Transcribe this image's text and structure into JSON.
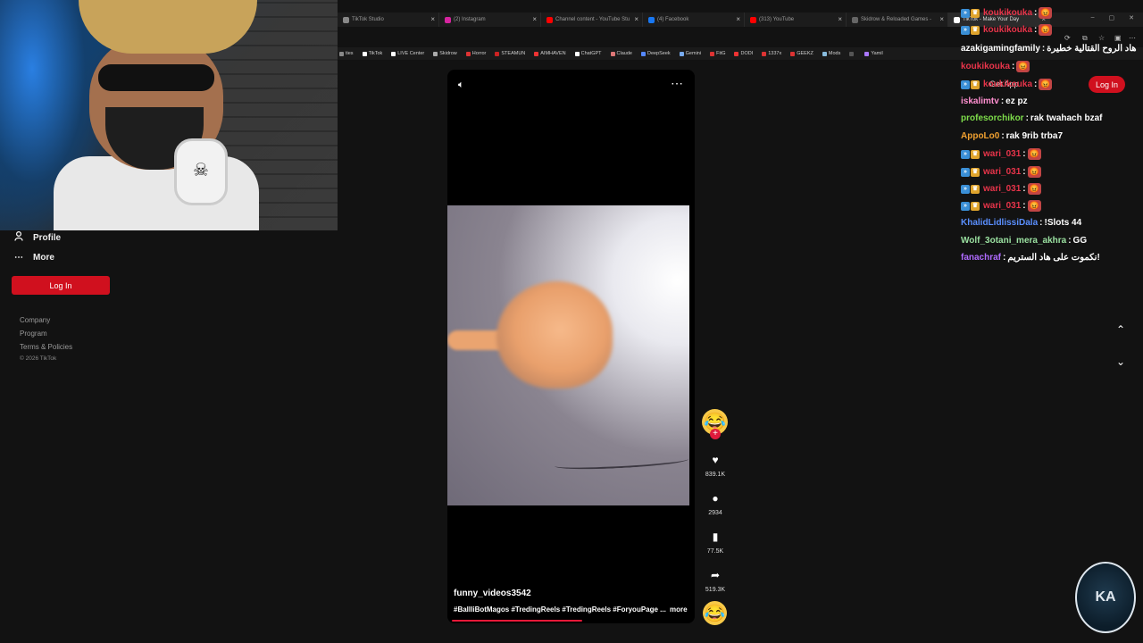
{
  "browser": {
    "tabs": [
      {
        "title": "TikTok Studio",
        "color": "#888888"
      },
      {
        "title": "(2) Instagram",
        "color": "#d6249f"
      },
      {
        "title": "Channel content - YouTube Stu",
        "color": "#ff0000"
      },
      {
        "title": "(4) Facebook",
        "color": "#1877f2"
      },
      {
        "title": "(313) YouTube",
        "color": "#ff0000"
      },
      {
        "title": "Skidrow & Reloaded Games - ",
        "color": "#666666"
      },
      {
        "title": "TikTok - Make Your Day",
        "color": "#ffffff"
      }
    ],
    "bookmarks": [
      "ties",
      "TikTok",
      "LIVE Center",
      "Skidrow",
      "Horror",
      "STEAMUN",
      "AIMHAVEN",
      "ChatGPT",
      "Claude",
      "DeepSeek",
      "Gemini",
      "FitG",
      "DODI",
      "1337x",
      "GEEKZ",
      "Mods",
      "",
      "Yamil"
    ],
    "favorites_label": "favorites"
  },
  "sidebar": {
    "profile_label": "Profile",
    "more_label": "More",
    "login_label": "Log In",
    "footer": [
      "Company",
      "Program",
      "Terms & Policies"
    ],
    "copyright": "© 2026 TikTok"
  },
  "header": {
    "get_app_label": "Get App",
    "login_label": "Log In"
  },
  "video": {
    "username": "funny_videos3542",
    "tags": "#BallliBotMagos #TredingReels #TredingReels #ForyouPage ...",
    "more_label": "more",
    "progress": 0.54,
    "likes": "839.1K",
    "comments": "2934",
    "saves": "77.5K",
    "shares": "519.3K"
  },
  "chat": {
    "messages": [
      {
        "user": "koukikouka",
        "color": "#e8344a",
        "text": "",
        "badges": true,
        "emote": true
      },
      {
        "user": "koukikouka",
        "color": "#e8344a",
        "text": "",
        "badges": true,
        "emote": true
      },
      {
        "user": "azakigamingfamily",
        "color": "#ffffff",
        "text": "هاد الروح القتالية خطيرة",
        "badges": false,
        "emote": false
      },
      {
        "user": "koukikouka",
        "color": "#e8344a",
        "text": "",
        "badges": false,
        "emote": true
      },
      {
        "user": "koukikouka",
        "color": "#e8344a",
        "text": "",
        "badges": true,
        "emote": true
      },
      {
        "user": "iskalimtv",
        "color": "#ff8fd0",
        "text": "ez pz",
        "badges": false,
        "emote": false
      },
      {
        "user": "profesorchikor",
        "color": "#7ddc4a",
        "text": "rak twahach bzaf",
        "badges": false,
        "emote": false
      },
      {
        "user": "AppoLo0",
        "color": "#f0a030",
        "text": "rak 9rib trba7",
        "badges": false,
        "emote": false
      },
      {
        "user": "wari_031",
        "color": "#e8344a",
        "text": "",
        "badges": true,
        "emote": true
      },
      {
        "user": "wari_031",
        "color": "#e8344a",
        "text": "",
        "badges": true,
        "emote": true
      },
      {
        "user": "wari_031",
        "color": "#e8344a",
        "text": "",
        "badges": true,
        "emote": true
      },
      {
        "user": "wari_031",
        "color": "#e8344a",
        "text": "",
        "badges": true,
        "emote": true
      },
      {
        "user": "KhalidLidlissiDala",
        "color": "#5a8fff",
        "text": "!Slots 44",
        "badges": false,
        "emote": false
      },
      {
        "user": "Wolf_3otani_mera_akhra",
        "color": "#9ae0a0",
        "text": "GG",
        "badges": false,
        "emote": false
      },
      {
        "user": "fanachraf",
        "color": "#b06bff",
        "text": "نكموت على هاد الستريم!",
        "badges": false,
        "emote": false
      }
    ]
  },
  "logo_text": "KA",
  "colors": {
    "accent": "#d0101e",
    "progress": "#e81838"
  }
}
